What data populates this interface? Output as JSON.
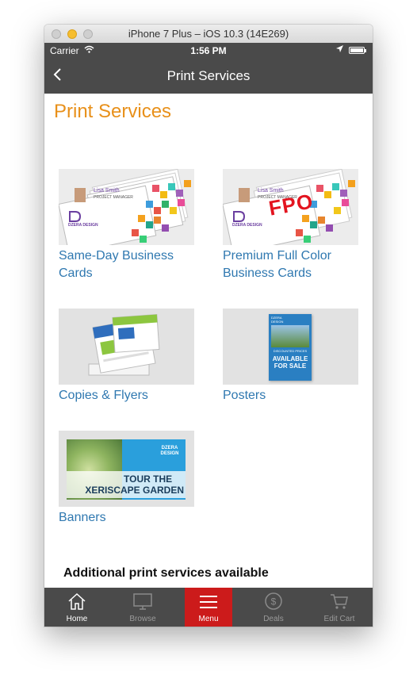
{
  "window": {
    "title": "iPhone 7 Plus – iOS 10.3 (14E269)"
  },
  "status": {
    "carrier": "Carrier",
    "time": "1:56 PM"
  },
  "nav": {
    "back_icon": "chevron-left-icon",
    "title": "Print Services"
  },
  "page": {
    "heading": "Print Services"
  },
  "products": [
    {
      "label": "Same-Day Business Cards",
      "card_name": "Lisa Smith",
      "card_title": "PROJECT MANAGER",
      "logo": "DZERA DESIGN"
    },
    {
      "label": "Premium Full Color Business Cards",
      "card_name": "Lisa Smith",
      "card_title": "PROJECT MANAGER",
      "logo": "DZERA DESIGN",
      "stamp": "FPO"
    },
    {
      "label": "Copies & Flyers"
    },
    {
      "label": "Posters",
      "poster_text": "AVAILABLE FOR SALE",
      "poster_sub": "DISCOUNTED PRICES",
      "logo": "DZERA DESIGN"
    },
    {
      "label": "Banners",
      "banner_line1": "TOUR THE",
      "banner_line2": "XERISCAPE GARDEN",
      "logo": "DZERA DESIGN"
    }
  ],
  "note": "Additional print services available",
  "tabs": [
    {
      "label": "Home",
      "icon": "home-icon"
    },
    {
      "label": "Browse",
      "icon": "monitor-icon"
    },
    {
      "label": "Menu",
      "icon": "hamburger-icon"
    },
    {
      "label": "Deals",
      "icon": "dollar-icon"
    },
    {
      "label": "Edit Cart",
      "icon": "cart-icon"
    }
  ],
  "colors": {
    "accent": "#e8901a",
    "link": "#2f78b0",
    "bar": "#4a4a4a",
    "menu_active": "#cc1b1b"
  }
}
